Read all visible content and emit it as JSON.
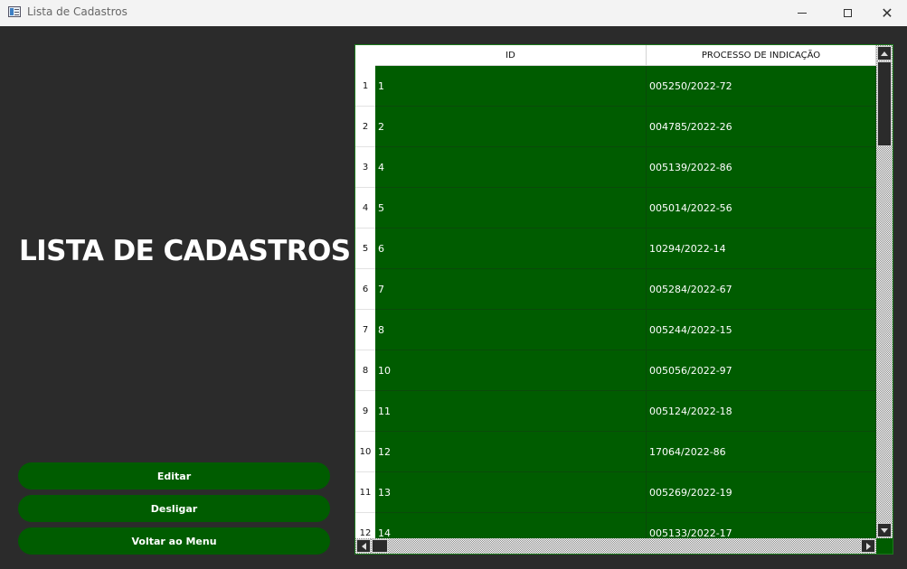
{
  "window": {
    "title": "Lista de Cadastros",
    "icon": "app-window-icon",
    "controls": {
      "minimize": "minimize-icon",
      "maximize": "maximize-icon",
      "close": "✕"
    }
  },
  "heading": "LISTA DE CADASTROS",
  "buttons": {
    "edit_label": "Editar",
    "dismiss_label": "Desligar",
    "back_label": "Voltar ao Menu"
  },
  "table": {
    "columns": [
      "ID",
      "PROCESSO DE INDICAÇÃO"
    ],
    "rows": [
      {
        "row": "1",
        "id": "1",
        "process": "005250/2022-72"
      },
      {
        "row": "2",
        "id": "2",
        "process": "004785/2022-26"
      },
      {
        "row": "3",
        "id": "4",
        "process": "005139/2022-86"
      },
      {
        "row": "4",
        "id": "5",
        "process": "005014/2022-56"
      },
      {
        "row": "5",
        "id": "6",
        "process": "10294/2022-14"
      },
      {
        "row": "6",
        "id": "7",
        "process": "005284/2022-67"
      },
      {
        "row": "7",
        "id": "8",
        "process": "005244/2022-15"
      },
      {
        "row": "8",
        "id": "10",
        "process": "005056/2022-97"
      },
      {
        "row": "9",
        "id": "11",
        "process": "005124/2022-18"
      },
      {
        "row": "10",
        "id": "12",
        "process": "17064/2022-86"
      },
      {
        "row": "11",
        "id": "13",
        "process": "005269/2022-19"
      },
      {
        "row": "12",
        "id": "14",
        "process": "005133/2022-17"
      }
    ]
  },
  "colors": {
    "background": "#2b2b2b",
    "accent_green": "#005c00",
    "header_bg": "#ffffff",
    "text_light": "#ffffff"
  }
}
